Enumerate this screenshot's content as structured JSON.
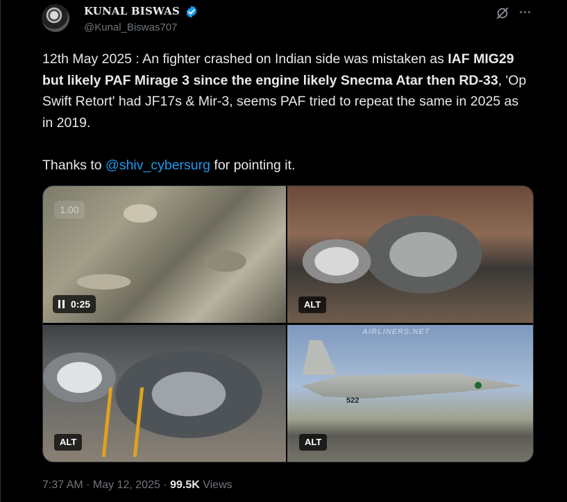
{
  "author": {
    "name": "KUNAL BISWAS",
    "handle": "@Kunal_Biswas707"
  },
  "tweet": {
    "part1": "12th May 2025 : An fighter crashed on Indian side was mistaken as ",
    "bold1": "IAF MIG29 but likely PAF Mirage 3 since the engine likely Snecma Atar then RD-33",
    "part2": ", 'Op Swift Retort' had JF17s & Mir-3, seems PAF tried to repeat the same in 2025 as in 2019.",
    "thanks_prefix": "Thanks to ",
    "mention": "@shiv_cybersurg",
    "thanks_suffix": " for pointing it."
  },
  "media": {
    "video": {
      "playback_rate": "1.00",
      "time": "0:25"
    },
    "alt_label": "ALT",
    "watermark": "AIRLINERS.NET",
    "tail_number": "522"
  },
  "meta": {
    "time": "7:37 AM",
    "sep": " · ",
    "date": "May 12, 2025",
    "views_count": "99.5K",
    "views_label": " Views"
  },
  "colors": {
    "background": "#000000",
    "text": "#e7e9ea",
    "muted": "#71767b",
    "link": "#1d9bf0",
    "verified": "#1d9bf0"
  },
  "icons": [
    "verified-badge-icon",
    "grok-icon",
    "more-icon",
    "pause-icon"
  ]
}
